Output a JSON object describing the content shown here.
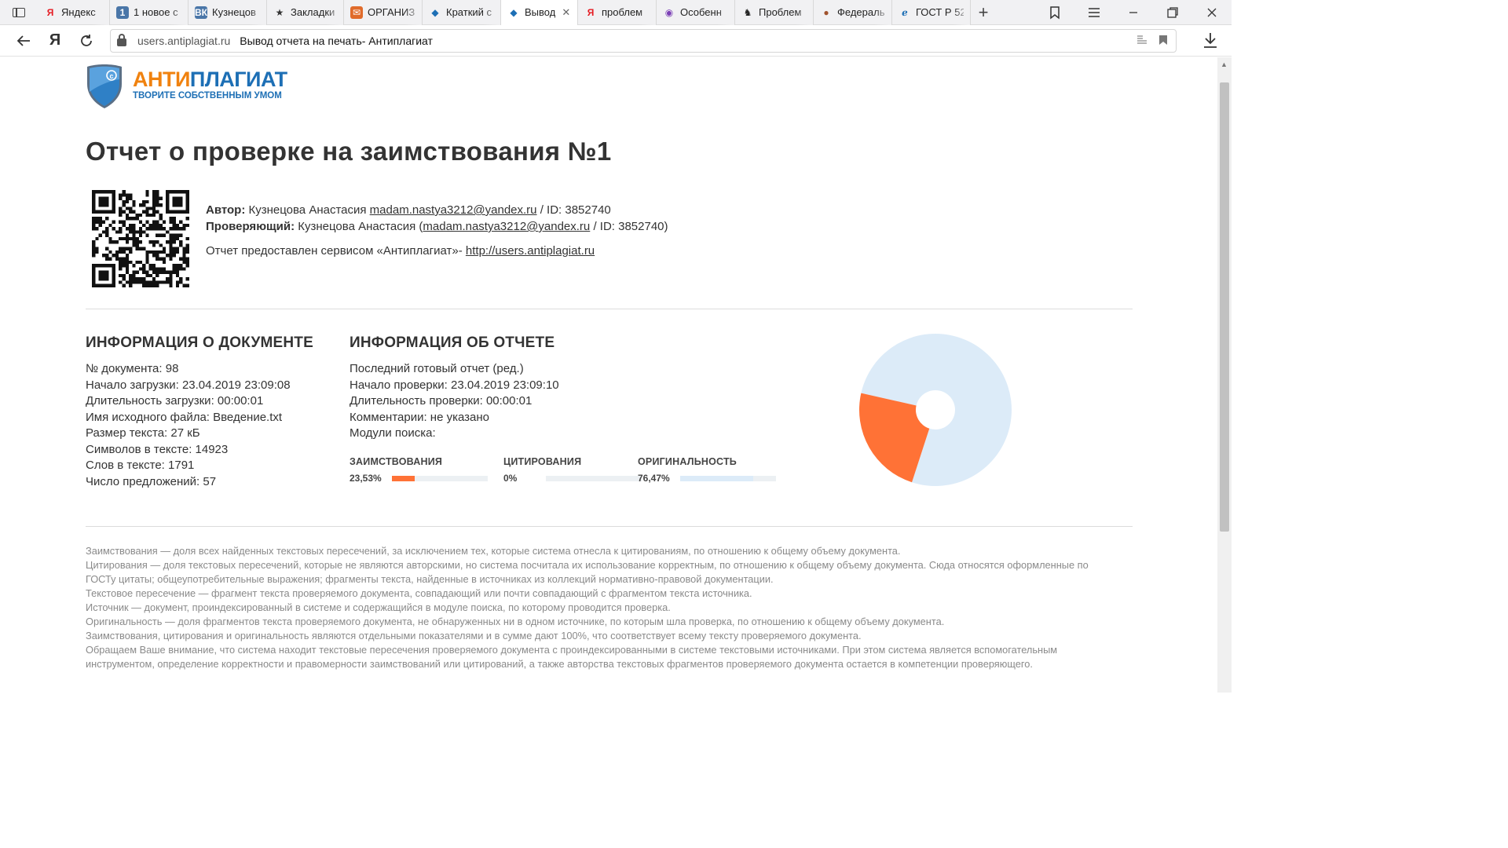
{
  "browser": {
    "tabs": [
      {
        "label": "Яндекс",
        "icon": "Я",
        "icon_color": "#e51c23",
        "icon_bg": "transparent",
        "width": 92
      },
      {
        "label": "1 новое с",
        "icon": "1",
        "icon_color": "#ffffff",
        "icon_bg": "#4a76a8",
        "width": 100
      },
      {
        "label": "Кузнецов",
        "icon": "ВК",
        "icon_color": "#ffffff",
        "icon_bg": "#4a76a8",
        "width": 100
      },
      {
        "label": "Закладки",
        "icon": "★",
        "icon_color": "#333333",
        "icon_bg": "transparent",
        "width": 98
      },
      {
        "label": "ОРГАНИЗ",
        "icon": "✉",
        "icon_color": "#ffffff",
        "icon_bg": "#e06b2b",
        "width": 100
      },
      {
        "label": "Краткий с",
        "icon": "◆",
        "icon_color": "#1d6fb5",
        "icon_bg": "transparent",
        "width": 100
      },
      {
        "label": "Вывод",
        "icon": "◆",
        "icon_color": "#1d6fb5",
        "icon_bg": "transparent",
        "width": 98,
        "active": true
      },
      {
        "label": "проблем",
        "icon": "Я",
        "icon_color": "#e51c23",
        "icon_bg": "transparent",
        "width": 100
      },
      {
        "label": "Особенн",
        "icon": "◉",
        "icon_color": "#7b3fb6",
        "icon_bg": "transparent",
        "width": 100
      },
      {
        "label": "Проблем",
        "icon": "♞",
        "icon_color": "#222222",
        "icon_bg": "transparent",
        "width": 100
      },
      {
        "label": "Федераль",
        "icon": "●",
        "icon_color": "#a0522d",
        "icon_bg": "transparent",
        "width": 100
      },
      {
        "label": "ГОСТ Р 52",
        "icon": "ℯ",
        "icon_color": "#1d6fb5",
        "icon_bg": "transparent",
        "width": 100
      }
    ],
    "url_domain": "users.antiplagiat.ru",
    "url_title": "Вывод отчета на печать- Антиплагиат"
  },
  "logo": {
    "word_part1": "АНТИ",
    "word_part2": "ПЛАГИАТ",
    "slogan": "ТВОРИТЕ СОБСТВЕННЫМ УМОМ"
  },
  "report": {
    "title": "Отчет о проверке на заимствования №1",
    "author_label": "Автор:",
    "author_name": "Кузнецова Анастасия",
    "author_email": "madam.nastya3212@yandex.ru",
    "author_id": "/ ID: 3852740",
    "reviewer_label": "Проверяющий:",
    "reviewer_name": "Кузнецова Анастасия (",
    "reviewer_email": "madam.nastya3212@yandex.ru",
    "reviewer_id": "/ ID: 3852740)",
    "provided_text": "Отчет предоставлен сервисом «Антиплагиат»-",
    "provided_link": "http://users.antiplagiat.ru"
  },
  "doc_info": {
    "title": "ИНФОРМАЦИЯ О ДОКУМЕНТЕ",
    "lines": [
      "№ документа: 98",
      "Начало загрузки: 23.04.2019 23:09:08",
      "Длительность загрузки: 00:00:01",
      "Имя исходного файла: Введение.txt",
      "Размер текста: 27 кБ",
      "Символов в тексте: 14923",
      "Слов в тексте: 1791",
      "Число предложений: 57"
    ]
  },
  "report_info": {
    "title": "ИНФОРМАЦИЯ ОБ ОТЧЕТЕ",
    "lines": [
      "Последний готовый отчет (ред.)",
      "Начало проверки: 23.04.2019 23:09:10",
      "Длительность проверки: 00:00:01",
      "Комментарии: не указано",
      "Модули поиска:"
    ]
  },
  "stats": [
    {
      "label": "ЗАИМСТВОВАНИЯ",
      "value_text": "23,53%",
      "value": 23.53,
      "color": "#ff7236"
    },
    {
      "label": "ЦИТИРОВАНИЯ",
      "value_text": "0%",
      "value": 0,
      "color": "#2fb56a"
    },
    {
      "label": "ОРИГИНАЛЬНОСТЬ",
      "value_text": "76,47%",
      "value": 76.47,
      "color": "#dcebf8"
    }
  ],
  "legend": [
    "Заимствования — доля всех найденных текстовых пересечений, за исключением тех, которые система отнесла к цитированиям, по отношению к общему объему документа.",
    "Цитирования — доля текстовых пересечений, которые не являются авторскими, но система посчитала их использование корректным, по отношению к общему объему документа. Сюда относятся оформленные по ГОСТу цитаты; общеупотребительные выражения; фрагменты текста, найденные в источниках из коллекций нормативно-правовой документации.",
    "Текстовое пересечение — фрагмент текста проверяемого документа, совпадающий или почти совпадающий с фрагментом текста источника.",
    "Источник — документ, проиндексированный в системе и содержащийся в модуле поиска, по которому проводится проверка.",
    "Оригинальность — доля фрагментов текста проверяемого документа, не обнаруженных ни в одном источнике, по которым шла проверка, по отношению к общему объему документа.",
    "Заимствования, цитирования и оригинальность являются отдельными показателями и в сумме дают 100%, что соответствует всему тексту проверяемого документа.",
    "Обращаем Ваше внимание, что система находит текстовые пересечения проверяемого документа с проиндексированными в системе текстовыми источниками. При этом система является вспомогательным инструментом, определение корректности и правомерности заимствований или цитирований, а также авторства текстовых фрагментов проверяемого документа остается в компетенции проверяющего."
  ]
}
